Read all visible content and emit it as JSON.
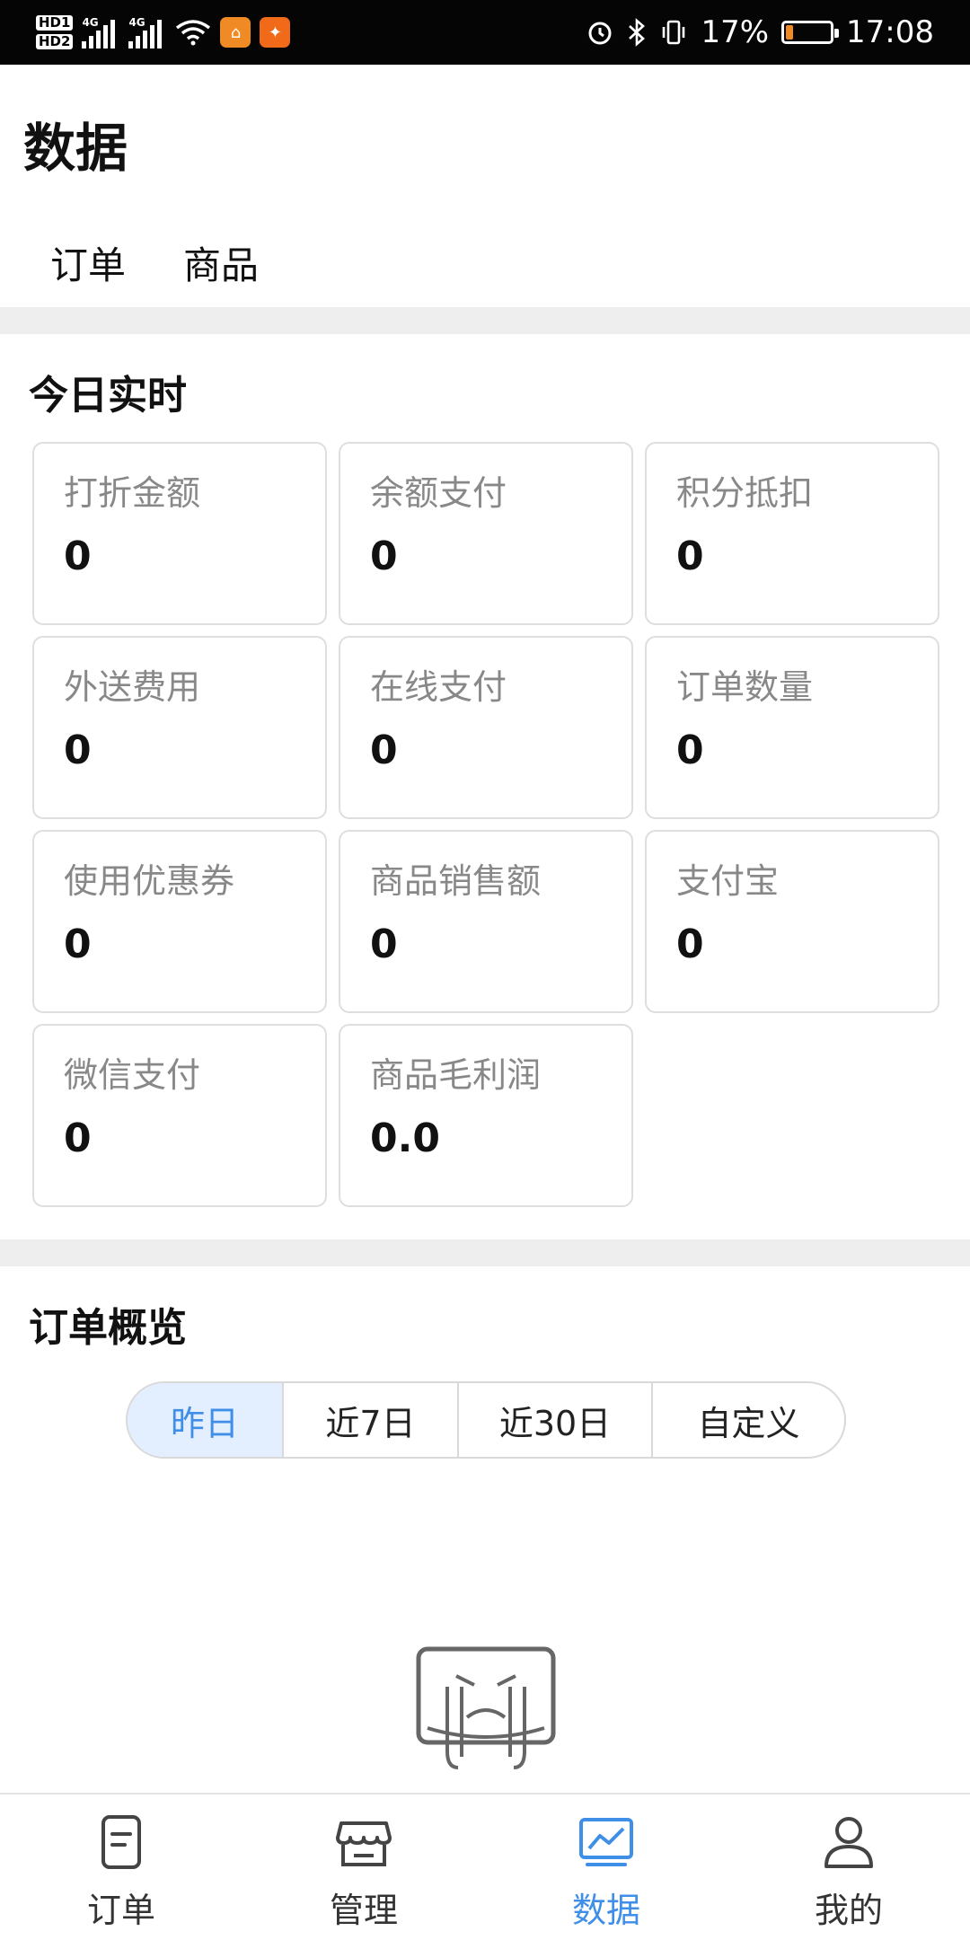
{
  "status_bar": {
    "hd1": "HD1",
    "hd2": "HD2",
    "net1": "4G",
    "net2": "4G",
    "battery_percent_text": "17%",
    "battery_level": 0.17,
    "time": "17:08"
  },
  "header": {
    "title": "数据",
    "tabs": [
      {
        "label": "订单"
      },
      {
        "label": "商品"
      }
    ]
  },
  "today": {
    "title": "今日实时",
    "stats": [
      {
        "label": "打折金额",
        "value": "0"
      },
      {
        "label": "余额支付",
        "value": "0"
      },
      {
        "label": "积分抵扣",
        "value": "0"
      },
      {
        "label": "外送费用",
        "value": "0"
      },
      {
        "label": "在线支付",
        "value": "0"
      },
      {
        "label": "订单数量",
        "value": "0"
      },
      {
        "label": "使用优惠券",
        "value": "0"
      },
      {
        "label": "商品销售额",
        "value": "0"
      },
      {
        "label": "支付宝",
        "value": "0"
      },
      {
        "label": "微信支付",
        "value": "0"
      },
      {
        "label": "商品毛利润",
        "value": "0.0"
      }
    ]
  },
  "overview": {
    "title": "订单概览",
    "segments": [
      {
        "label": "昨日"
      },
      {
        "label": "近7日"
      },
      {
        "label": "近30日"
      },
      {
        "label": "自定义"
      }
    ],
    "active_segment": 0
  },
  "bottom_nav": [
    {
      "label": "订单",
      "icon": "order-icon"
    },
    {
      "label": "管理",
      "icon": "store-icon"
    },
    {
      "label": "数据",
      "icon": "chart-icon"
    },
    {
      "label": "我的",
      "icon": "profile-icon"
    }
  ],
  "colors": {
    "accent": "#3f8ee8",
    "segment_active_bg": "#e3efff",
    "battery": "#f08a24"
  }
}
